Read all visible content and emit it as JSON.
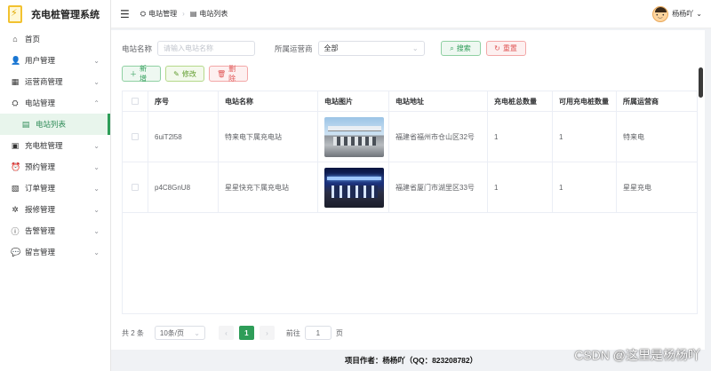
{
  "app": {
    "title": "充电桩管理系统"
  },
  "sidebar": {
    "items": [
      {
        "icon": "home-icon",
        "glyph": "⌂",
        "label": "首页",
        "arrow": ""
      },
      {
        "icon": "user-icon",
        "glyph": "👤",
        "label": "用户管理",
        "arrow": "⌄"
      },
      {
        "icon": "building-icon",
        "glyph": "▦",
        "label": "运营商管理",
        "arrow": "⌄"
      },
      {
        "icon": "station-icon",
        "glyph": "⛭",
        "label": "电站管理",
        "arrow": "⌃"
      },
      {
        "icon": "list-icon",
        "glyph": "▤",
        "label": "电站列表",
        "arrow": "",
        "active": true
      },
      {
        "icon": "charger-icon",
        "glyph": "▣",
        "label": "充电桩管理",
        "arrow": "⌄"
      },
      {
        "icon": "alarm-clock-icon",
        "glyph": "⏰",
        "label": "预约管理",
        "arrow": "⌄"
      },
      {
        "icon": "order-icon",
        "glyph": "▧",
        "label": "订单管理",
        "arrow": "⌄"
      },
      {
        "icon": "repair-icon",
        "glyph": "✲",
        "label": "报修管理",
        "arrow": "⌄"
      },
      {
        "icon": "warning-icon",
        "glyph": "ⓘ",
        "label": "告警管理",
        "arrow": "⌄"
      },
      {
        "icon": "message-icon",
        "glyph": "💬",
        "label": "留言管理",
        "arrow": "⌄"
      }
    ]
  },
  "header": {
    "breadcrumb": [
      "电站管理",
      "电站列表"
    ],
    "user_name": "杨杨吖",
    "user_arrow": "⌄"
  },
  "filters": {
    "name_label": "电站名称",
    "name_placeholder": "请输入电站名称",
    "operator_label": "所属运营商",
    "operator_value": "全部",
    "search_label": "搜索",
    "reset_label": "重置"
  },
  "actions": {
    "add_label": "新增",
    "edit_label": "修改",
    "delete_label": "删除"
  },
  "table": {
    "headers": [
      "",
      "序号",
      "电站名称",
      "电站图片",
      "电站地址",
      "充电桩总数量",
      "可用充电桩数量",
      "所属运营商"
    ],
    "rows": [
      {
        "id": "6uiT2l58",
        "name": "特来电下属充电站",
        "address": "福建省福州市仓山区32号",
        "total": "1",
        "available": "1",
        "operator": "特来电"
      },
      {
        "id": "p4C8GnU8",
        "name": "星星快充下属充电站",
        "address": "福建省厦门市湖里区33号",
        "total": "1",
        "available": "1",
        "operator": "星星充电"
      }
    ]
  },
  "pagination": {
    "total_text": "共 2 条",
    "page_size": "10条/页",
    "current_page": "1",
    "goto_label": "前往",
    "goto_value": "1",
    "page_unit": "页"
  },
  "footer": {
    "text": "项目作者：杨杨吖（QQ：823208782）"
  },
  "watermark": "CSDN @这里是杨杨吖"
}
